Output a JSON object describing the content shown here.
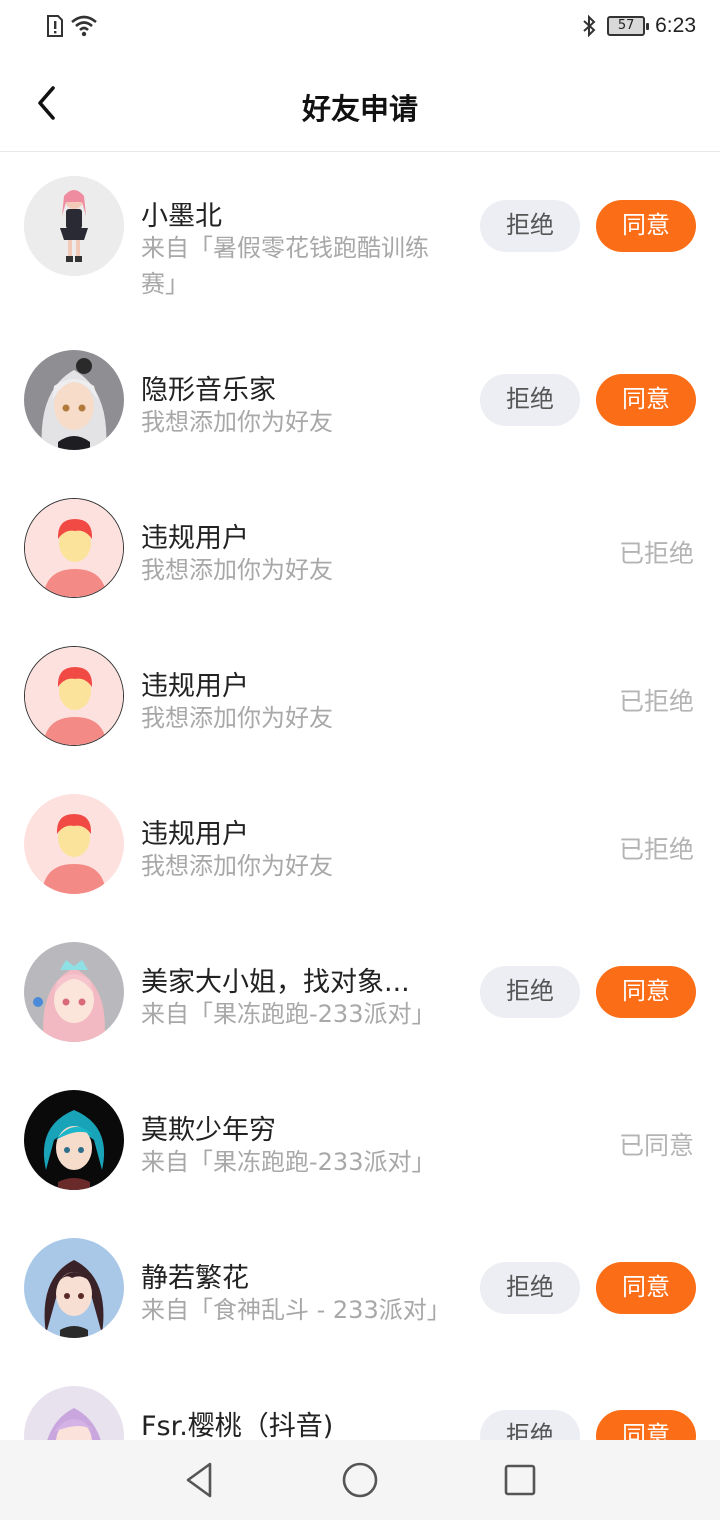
{
  "status_bar": {
    "time": "6:23",
    "battery": "57"
  },
  "header": {
    "title": "好友申请"
  },
  "colors": {
    "accent": "#fb6d16",
    "reject_bg": "#eceef3",
    "muted_text": "#a8a8a8"
  },
  "requests": [
    {
      "name": "小墨北",
      "subtitle": "来自「暑假零花钱跑酷训练赛」",
      "reject_label": "拒绝",
      "agree_label": "同意",
      "avatar": "pink-hair-character-avatar"
    },
    {
      "name": "隐形音乐家",
      "subtitle": "我想添加你为好友",
      "reject_label": "拒绝",
      "agree_label": "同意",
      "avatar": "silver-hair-character-avatar"
    },
    {
      "name": "违规用户",
      "subtitle": "我想添加你为好友",
      "status": "已拒绝",
      "avatar": "default-user-avatar"
    },
    {
      "name": "违规用户",
      "subtitle": "我想添加你为好友",
      "status": "已拒绝",
      "avatar": "default-user-avatar"
    },
    {
      "name": "违规用户",
      "subtitle": "我想添加你为好友",
      "status": "已拒绝",
      "avatar": "default-user-avatar"
    },
    {
      "name": "美家大小姐，找对象...",
      "subtitle": "来自「果冻跑跑-233派对」",
      "reject_label": "拒绝",
      "agree_label": "同意",
      "avatar": "tiara-character-avatar"
    },
    {
      "name": "莫欺少年穷",
      "subtitle": "来自「果冻跑跑-233派对」",
      "status": "已同意",
      "avatar": "teal-hair-character-avatar"
    },
    {
      "name": "静若繁花",
      "subtitle": "来自「食神乱斗 - 233派对」",
      "reject_label": "拒绝",
      "agree_label": "同意",
      "avatar": "dark-hair-character-avatar"
    },
    {
      "name": "Fsr.樱桃（抖音)",
      "reject_label": "拒绝",
      "agree_label": "同意",
      "avatar": "lavender-hair-character-avatar"
    }
  ],
  "nav": {
    "back": "back-triangle-icon",
    "home": "home-circle-icon",
    "recent": "recents-square-icon"
  }
}
